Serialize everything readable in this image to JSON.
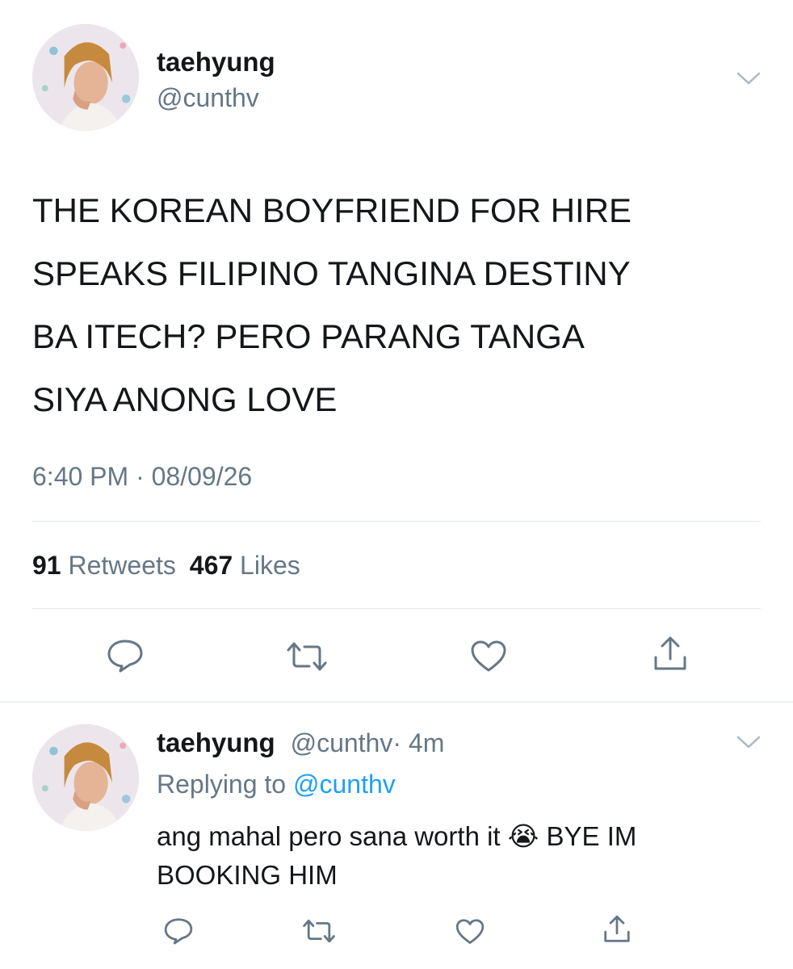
{
  "main_tweet": {
    "display_name": "taehyung",
    "handle": "@cunthv",
    "text_lines": [
      "THE KOREAN BOYFRIEND FOR HIRE",
      "SPEAKS FILIPINO TANGINA DESTINY",
      "BA ITECH? PERO PARANG TANGA",
      "SIYA ANONG LOVE"
    ],
    "timestamp": "6:40 PM · 08/09/26",
    "retweets_count": "91",
    "retweets_label": "Retweets",
    "likes_count": "467",
    "likes_label": "Likes"
  },
  "reply": {
    "display_name": "taehyung",
    "handle": "@cunthv",
    "time": "· 4m",
    "replying_prefix": "Replying to",
    "replying_handle": "@cunthv",
    "text_part1": "ang mahal pero sana worth it",
    "emoji": "😭",
    "text_part2": "BYE IM",
    "text_line2": "BOOKING HIM"
  },
  "icons": [
    "reply-icon",
    "retweet-icon",
    "like-icon",
    "share-icon",
    "chevron-down-icon"
  ],
  "colors": {
    "text": "#14171a",
    "secondary": "#657786",
    "link": "#1da1f2",
    "divider": "#e1e8ed"
  }
}
